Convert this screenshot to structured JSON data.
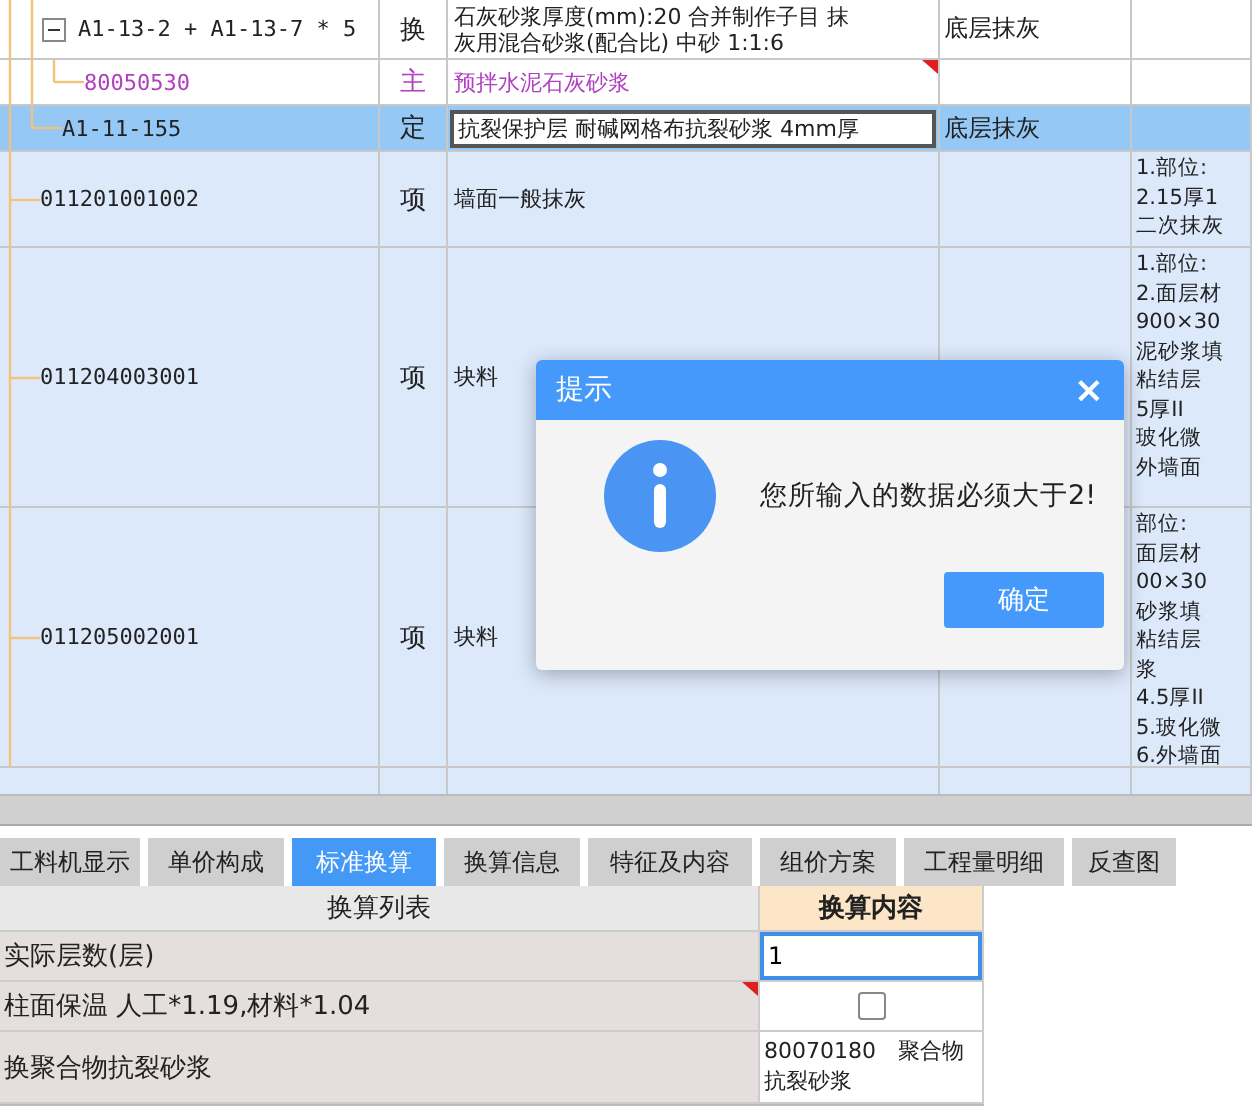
{
  "tree": {
    "continued": [
      {
        "code": "A1-13-2 + A1-13-7 * 5",
        "type": "换",
        "name": [
          "石灰砂浆厚度(mm):20  合并制作子目 抹",
          "灰用混合砂浆(配合比) 中砂 1:1:6"
        ],
        "feature": "底层抹灰",
        "kind": "quota",
        "selected": false,
        "expanded": true,
        "flag": false,
        "children": [
          {
            "code": "80050530",
            "type": "主",
            "name": [
              "预拌水泥石灰砂浆"
            ],
            "kind": "material",
            "selected": false,
            "flag": true
          }
        ]
      },
      {
        "code": "A1-11-155",
        "type": "定",
        "name": [
          "抗裂保护层 耐碱网格布抗裂砂浆 4mm厚"
        ],
        "feature": "底层抹灰",
        "kind": "quota",
        "selected": true,
        "flag": false
      }
    ],
    "items": [
      {
        "code": "011201001002",
        "type": "项",
        "name": [
          "墙面一般抹灰"
        ],
        "kind": "item",
        "selected": false,
        "flag": false,
        "desc": [
          "1.部位:",
          "2.15厚1",
          "二次抹灰"
        ]
      },
      {
        "code": "011204003001",
        "type": "项",
        "name": [
          "块料"
        ],
        "kind": "item",
        "selected": false,
        "desc": [
          "1.部位:",
          "2.面层材",
          "900×30",
          "泥砂浆填",
          "粘结层",
          "5厚II",
          "玻化微",
          "外墙面"
        ]
      },
      {
        "code": "011205002001",
        "type": "项",
        "name": [
          "块料"
        ],
        "kind": "item",
        "selected": false,
        "desc": [
          "部位:",
          "面层材",
          "00×30",
          "砂浆填",
          "粘结层",
          "浆",
          "4.5厚II",
          "5.玻化微",
          "6.外墙面"
        ]
      }
    ]
  },
  "tabs": [
    {
      "label": "工料机显示",
      "selected": false
    },
    {
      "label": "单价构成",
      "selected": false
    },
    {
      "label": "标准换算",
      "selected": true
    },
    {
      "label": "换算信息",
      "selected": false
    },
    {
      "label": "特征及内容",
      "selected": false
    },
    {
      "label": "组价方案",
      "selected": false
    },
    {
      "label": "工程量明细",
      "selected": false
    },
    {
      "label": "反查图",
      "selected": false
    }
  ],
  "conversion": {
    "columns": [
      "换算列表",
      "换算内容"
    ],
    "rows": [
      {
        "label": "实际层数(层)",
        "kind": "input",
        "value": "1",
        "flag": false
      },
      {
        "label": "柱面保温 人工*1.19,材料*1.04",
        "kind": "checkbox",
        "checked": false,
        "flag": true
      },
      {
        "label": "换聚合物抗裂砂浆",
        "kind": "text",
        "value": "80070180　聚合物抗裂砂浆",
        "flag": false
      }
    ]
  },
  "dialog": {
    "title": "提示",
    "close": "×",
    "message": "您所输入的数据必须大于2!",
    "button": "确定"
  }
}
